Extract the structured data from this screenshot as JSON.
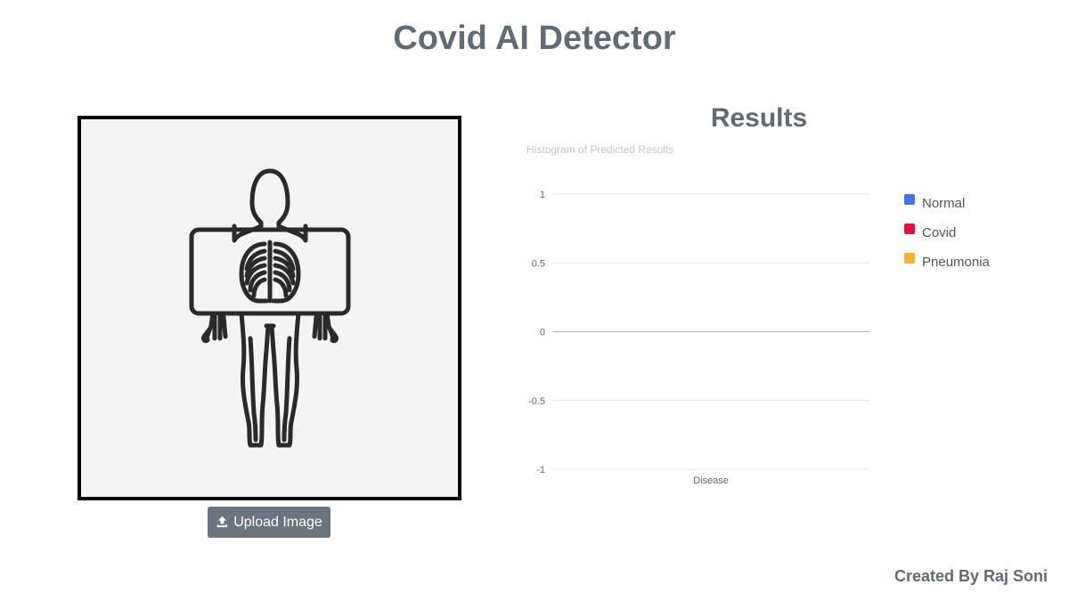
{
  "header": {
    "title": "Covid AI Detector"
  },
  "xray_panel": {
    "illustration_icon": "xray-body-icon",
    "upload_label": "Upload Image",
    "upload_icon": "upload-icon"
  },
  "results": {
    "title": "Results"
  },
  "footer": {
    "credit": "Created By Raj Soni"
  },
  "chart_data": {
    "type": "bar",
    "title": "Histogram of Predicted Results",
    "categories": [
      "Disease"
    ],
    "series": [
      {
        "name": "Normal",
        "color": "#4a72e8",
        "values": [
          0
        ]
      },
      {
        "name": "Covid",
        "color": "#e8103c",
        "values": [
          0
        ]
      },
      {
        "name": "Pneumonia",
        "color": "#f4b136",
        "values": [
          0
        ]
      }
    ],
    "yticks": [
      "1",
      "0.5",
      "0",
      "-0.5",
      "-1"
    ],
    "ylim": [
      -1,
      1
    ],
    "xlabel": "",
    "ylabel": "",
    "grid": true,
    "legend": "right"
  }
}
